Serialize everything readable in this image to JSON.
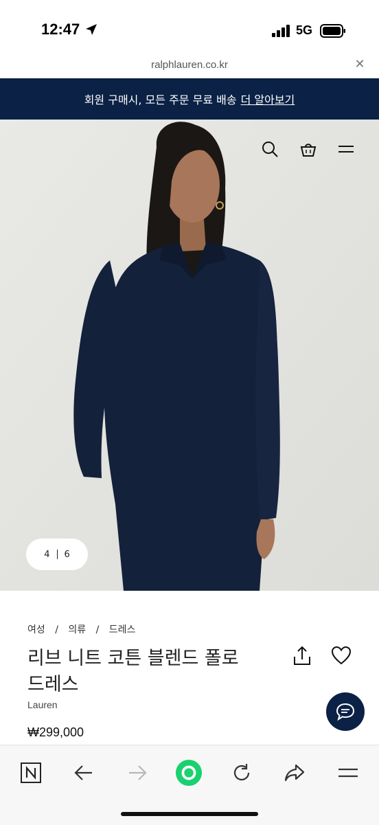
{
  "status_bar": {
    "time": "12:47",
    "network": "5G",
    "icons": [
      "location-arrow-icon",
      "signal-icon",
      "battery-icon"
    ]
  },
  "browser": {
    "url": "ralphlauren.co.kr",
    "close_icon": "close-icon"
  },
  "promo": {
    "text": "회원 구매시, 모든 주문 무료 배송",
    "link": "더 알아보기",
    "background": "#0b2145"
  },
  "header_icons": [
    "search-icon",
    "shopping-bag-icon",
    "menu-icon"
  ],
  "gallery": {
    "current": "4",
    "total": "6"
  },
  "product": {
    "breadcrumbs": [
      "여성",
      "의류",
      "드레스"
    ],
    "breadcrumb_separator": "/",
    "title": "리브 니트 코튼 블렌드 폴로 드레스",
    "brand": "Lauren",
    "price": "₩299,000"
  },
  "colors": {
    "accent": "#0b2145",
    "go_button": "#19d16f"
  }
}
